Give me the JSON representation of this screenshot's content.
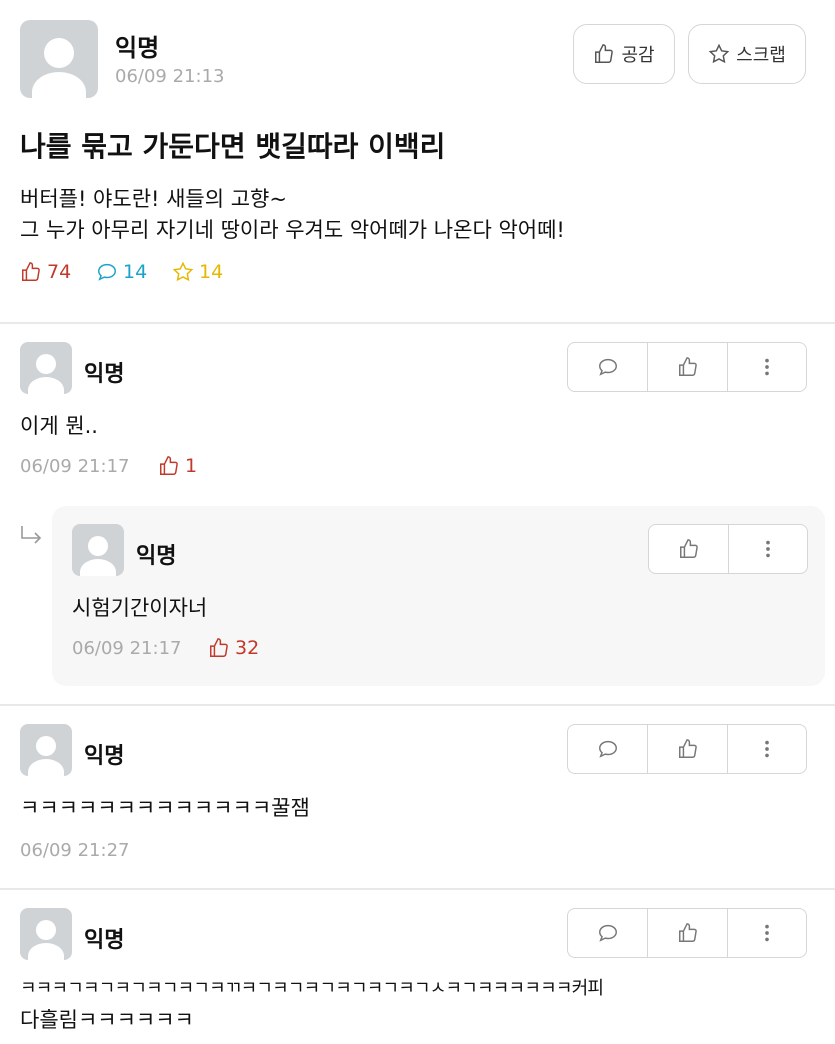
{
  "post": {
    "author": "익명",
    "time": "06/09 21:13",
    "like_button": "공감",
    "scrap_button": "스크랩",
    "title": "나를 묶고 가둔다면 뱃길따라 이백리",
    "body_line1": "버터플! 야도란! 새들의 고향~",
    "body_line2": "그 누가 아무리 자기네 땅이라 우겨도 악어떼가 나온다 악어떼!",
    "likes": "74",
    "comments": "14",
    "scraps": "14",
    "colors": {
      "likes": "#c0392b",
      "comments": "#1aa3c8",
      "scraps": "#e5b800"
    }
  },
  "comments": [
    {
      "author": "익명",
      "text": "이게 뭔..",
      "time": "06/09 21:17",
      "likes": "1"
    },
    {
      "author": "익명",
      "text": "시험기간이자너",
      "time": "06/09 21:17",
      "likes": "32"
    },
    {
      "author": "익명",
      "text": "ㅋㅋㅋㅋㅋㅋㅋㅋㅋㅋㅋㅋㅋ꿀잼",
      "time": "06/09 21:27"
    },
    {
      "author": "익명",
      "text_line1": "ㅋㅋㅋㄱㅋㄱㅋㄱㅋㄱㅋㄱㅋㄲㅋㄱㅋㄱㅋㄱㅋㄱㅋㄱㅋㄱㅅㅋㄱㅋㅋㅋㅋㅋㅋ커피",
      "text_line2": "다흘림ㅋㅋㅋㅋㅋㅋ"
    }
  ],
  "icons": [
    "avatar-icon",
    "thumbs-up-icon",
    "star-icon",
    "speech-bubble-icon",
    "more-vertical-icon",
    "reply-arrow-icon"
  ]
}
